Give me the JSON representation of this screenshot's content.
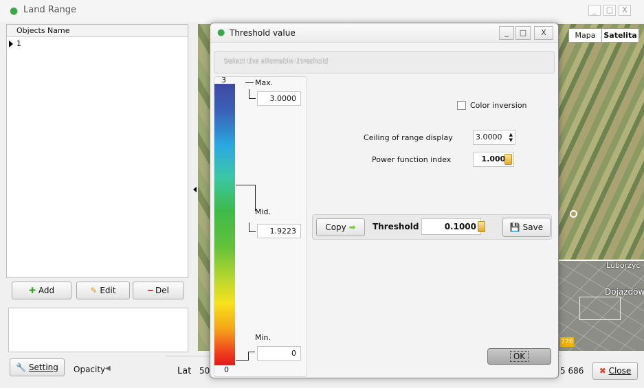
{
  "window": {
    "title": "Land Range",
    "min": "_",
    "max": "□",
    "close": "X"
  },
  "left_panel": {
    "column_header": "Objects Name",
    "rows": [
      "1"
    ]
  },
  "buttons": {
    "add": "Add",
    "edit": "Edit",
    "del": "Del"
  },
  "bottom": {
    "setting": "Setting",
    "opacity_label": "Opacity",
    "opacity_arrow": "◀",
    "lat_label": "Lat",
    "lat_value": "50",
    "coord_value": "5 686",
    "close": "Close"
  },
  "map": {
    "mapa_tab": "Mapa",
    "satelita_tab": "Satelita",
    "place1": "Luborzyc",
    "place2": "Dojazdów",
    "road_badge": "776"
  },
  "dialog": {
    "title": "Threshold value",
    "min": "_",
    "max": "□",
    "close": "X",
    "hint": "Select the allowable threshold",
    "scale": {
      "top_number": "3",
      "bottom_number": "0",
      "max_label": "Max.",
      "max_value": "3.0000",
      "mid_label": "Mid.",
      "mid_value": "1.9223",
      "min_label": "Min.",
      "min_value": "0"
    },
    "color_inversion_label": "Color inversion",
    "ceiling_label": "Ceiling of range display",
    "ceiling_value": "3.0000",
    "power_label": "Power function index",
    "power_value": "1.0000",
    "copy_label": "Copy",
    "threshold_label": "Threshold",
    "threshold_value": "0.1000",
    "save_label": "Save",
    "ok_label": "OK"
  },
  "colors": {
    "accent_green": "#4caf2a",
    "del_red": "#e0402a",
    "calc_orange": "#e6a92a"
  }
}
